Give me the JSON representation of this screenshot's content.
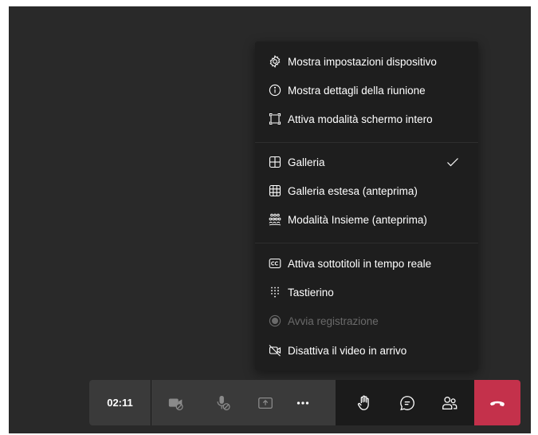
{
  "menu": {
    "items": [
      {
        "label": "Mostra impostazioni dispositivo",
        "icon": "gear-icon"
      },
      {
        "label": "Mostra dettagli della riunione",
        "icon": "info-icon"
      },
      {
        "label": "Attiva modalità schermo intero",
        "icon": "fullscreen-icon"
      },
      {
        "label": "Galleria",
        "icon": "gallery-icon",
        "checked": true
      },
      {
        "label": "Galleria estesa (anteprima)",
        "icon": "large-gallery-icon"
      },
      {
        "label": "Modalità Insieme (anteprima)",
        "icon": "together-mode-icon"
      },
      {
        "label": "Attiva sottotitoli in tempo reale",
        "icon": "closed-captions-icon"
      },
      {
        "label": "Tastierino",
        "icon": "dialpad-icon"
      },
      {
        "label": "Avvia registrazione",
        "icon": "record-icon",
        "disabled": true
      },
      {
        "label": "Disattiva il video in arrivo",
        "icon": "video-off-icon"
      }
    ]
  },
  "toolbar": {
    "timer": "02:11",
    "buttons": [
      {
        "name": "camera-off-button",
        "icon": "camera-off-icon",
        "disabled": true
      },
      {
        "name": "mic-off-button",
        "icon": "mic-off-icon",
        "disabled": true
      },
      {
        "name": "share-screen-button",
        "icon": "share-screen-icon",
        "disabled": true
      },
      {
        "name": "more-actions-button",
        "icon": "more-icon"
      },
      {
        "name": "raise-hand-button",
        "icon": "hand-icon"
      },
      {
        "name": "chat-button",
        "icon": "chat-icon"
      },
      {
        "name": "participants-button",
        "icon": "people-icon"
      },
      {
        "name": "hang-up-button",
        "icon": "hang-up-icon"
      }
    ]
  },
  "colors": {
    "stage": "#292929",
    "menu_bg": "#1e1e1e",
    "toolbar_bg": "#1b1b1b",
    "disabled_group": "#3a3a3a",
    "hangup": "#c4314b",
    "text": "#ffffff",
    "disabled_text": "#6a6a6a"
  }
}
